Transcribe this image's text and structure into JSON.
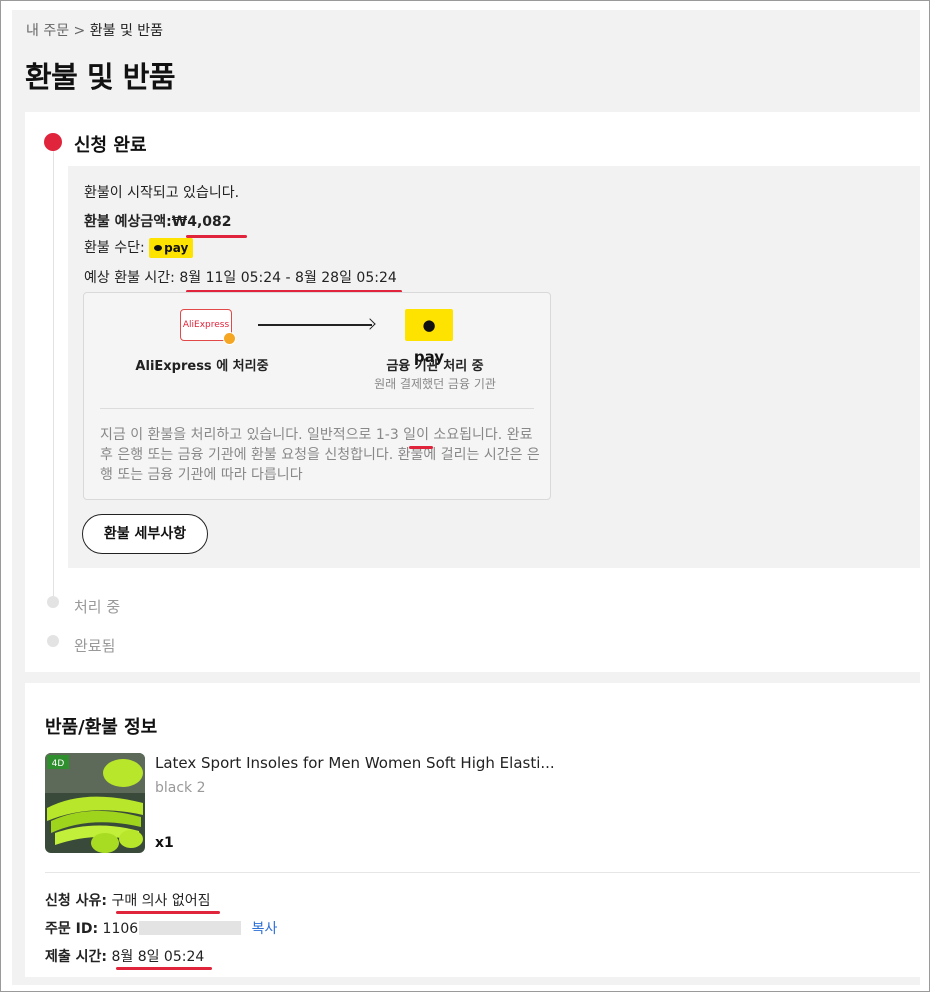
{
  "breadcrumb": {
    "parent": "내 주문",
    "separator": ">",
    "current": "환불 및 반품"
  },
  "page_title": "환불 및 반품",
  "status": {
    "steps": [
      {
        "label": "신청 완료",
        "state": "active"
      },
      {
        "label": "처리 중",
        "state": "pending"
      },
      {
        "label": "완료됨",
        "state": "pending"
      }
    ],
    "message": "환불이 시작되고 있습니다.",
    "amount_label": "환불 예상금액:",
    "amount_value": "₩4,082",
    "method_label": "환불 수단:",
    "method_badge": "pay",
    "time_label": "예상 환불 시간:",
    "time_value": "8월 11일 05:24 - 8월 28일 05:24",
    "flow": {
      "from_logo": "AliExpress",
      "from_label": "AliExpress 에 처리중",
      "to_logo": "pay",
      "to_label": "금융 기관 처리 중",
      "to_sublabel": "원래 결제했던 금융 기관",
      "description": "지금 이 환불을 처리하고 있습니다. 일반적으로 1-3 일이 소요됩니다. 완료 후 은행 또는 금융 기관에 환불 요청을 신청합니다. 환불에 걸리는 시간은 은행 또는 금융 기관에 따라 다릅니다"
    },
    "details_button": "환불 세부사항"
  },
  "return_info": {
    "title": "반품/환불 정보",
    "product": {
      "name": "Latex Sport Insoles for Men Women Soft High Elasti...",
      "variant": "black 2",
      "quantity": "x1"
    },
    "reason_label": "신청 사유:",
    "reason_value": "구매 의사 없어짐",
    "order_id_label": "주문 ID:",
    "order_id_value": "1106",
    "copy_label": "복사",
    "submitted_label": "제출 시간:",
    "submitted_value": "8월 8일 05:24"
  },
  "colors": {
    "accent": "#e0243b",
    "kakao_yellow": "#ffe300",
    "link": "#2e6fd6"
  }
}
